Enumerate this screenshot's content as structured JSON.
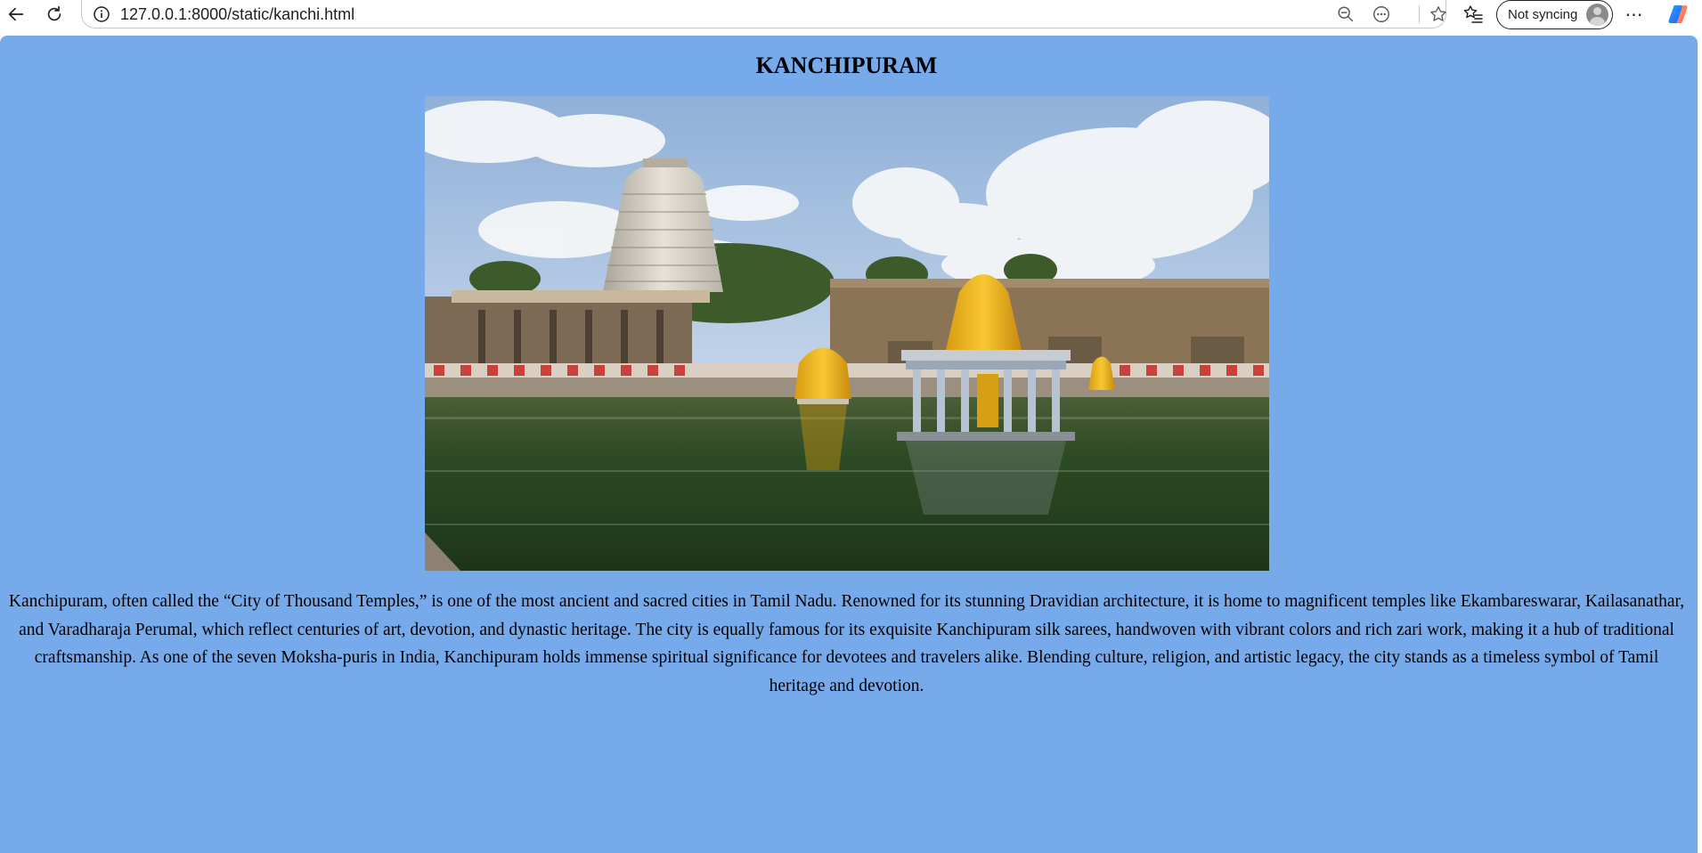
{
  "browser": {
    "url": "127.0.0.1:8000/static/kanchi.html",
    "profile_label": "Not syncing",
    "icons": {
      "back": "back-arrow-icon",
      "refresh": "refresh-icon",
      "site_info": "info-icon",
      "zoom_out": "zoom-out-icon",
      "reading_mode": "more-options-circle-icon",
      "add_favorite": "star-icon",
      "favorites": "favorites-list-icon",
      "more": "ellipsis-icon",
      "copilot": "copilot-icon",
      "avatar": "profile-avatar-icon"
    }
  },
  "page": {
    "title": "KANCHIPURAM",
    "background_color": "#77aaea",
    "description": "Kanchipuram, often called the “City of Thousand Temples,” is one of the most ancient and sacred cities in Tamil Nadu. Renowned for its stunning Dravidian architecture, it is home to magnificent temples like Ekambareswarar, Kailasanathar, and Varadharaja Perumal, which reflect centuries of art, devotion, and dynastic heritage. The city is equally famous for its exquisite Kanchipuram silk sarees, handwoven with vibrant colors and rich zari work, making it a hub of traditional craftsmanship. As one of the seven Moksha-puris in India, Kanchipuram holds immense spiritual significance for devotees and travelers alike. Blending culture, religion, and artistic legacy, the city stands as a timeless symbol of Tamil heritage and devotion."
  }
}
